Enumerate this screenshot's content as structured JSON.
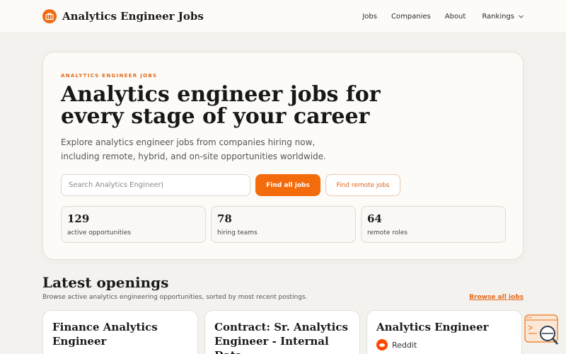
{
  "nav": {
    "brand": "Analytics Engineer Jobs",
    "links": [
      "Jobs",
      "Companies",
      "About"
    ],
    "rankings": "Rankings"
  },
  "hero": {
    "eyebrow": "ANALYTICS ENGINEER JOBS",
    "title": "Analytics engineer jobs for every stage of your career",
    "subtitle": "Explore analytics engineer jobs from companies hiring now, including remote, hybrid, and on-site opportunities worldwide.",
    "search_placeholder": "Search Analytics Engineer|",
    "find_all": "Find all jobs",
    "find_remote": "Find remote jobs",
    "stats": [
      {
        "value": "129",
        "label": "active opportunities"
      },
      {
        "value": "78",
        "label": "hiring teams"
      },
      {
        "value": "64",
        "label": "remote roles"
      }
    ]
  },
  "latest": {
    "title": "Latest openings",
    "subtitle": "Browse active analytics engineering opportunities, sorted by most recent postings.",
    "browse": "Browse all jobs",
    "cards": [
      {
        "title": "Finance Analytics Engineer",
        "company": ""
      },
      {
        "title": "Contract: Sr. Analytics Engineer - Internal Data",
        "company": ""
      },
      {
        "title": "Analytics Engineer",
        "company": "Reddit"
      }
    ]
  },
  "colors": {
    "accent": "#f36b0b",
    "background": "#f4f2ee"
  }
}
